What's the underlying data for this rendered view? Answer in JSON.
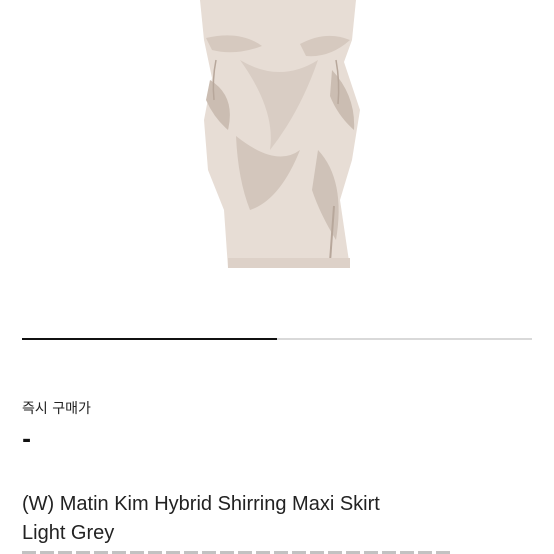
{
  "product": {
    "image_icon": "skirt-photo",
    "colors": {
      "fabric": "#e7ddd5",
      "fabric_shadow": "#cbbdb2",
      "fabric_dark": "#b7a79b"
    }
  },
  "carousel": {
    "progress": 0.5
  },
  "price": {
    "label": "즉시 구매가",
    "value": "-"
  },
  "title": {
    "line1": "(W) Matin Kim Hybrid Shirring Maxi Skirt",
    "line2": "Light Grey"
  }
}
